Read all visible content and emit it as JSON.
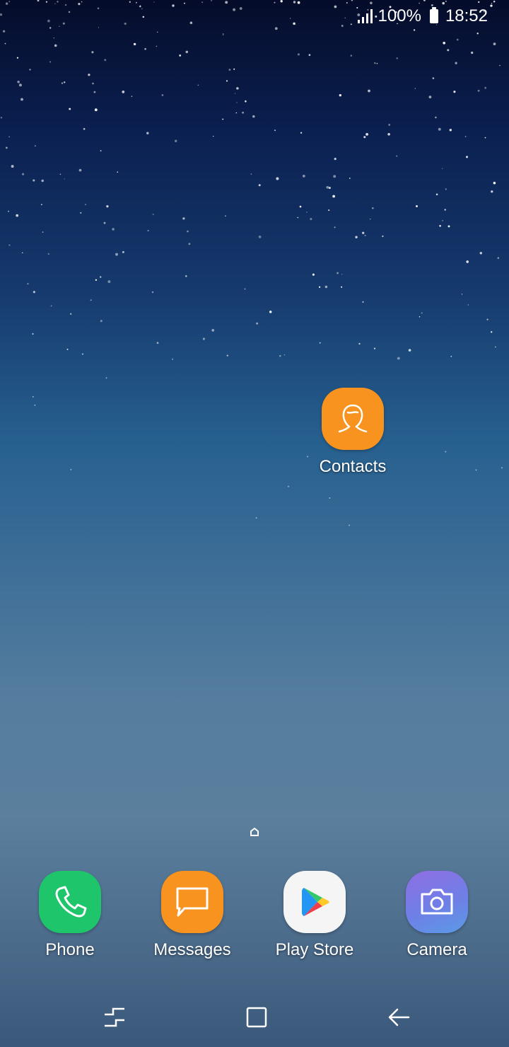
{
  "status_bar": {
    "battery_text": "100%",
    "time": "18:52",
    "icons": [
      "signal-icon",
      "battery-icon"
    ]
  },
  "home_screen": {
    "apps": [
      {
        "label": "Contacts",
        "icon": "contacts-icon",
        "color": "#f7931e"
      }
    ]
  },
  "dock": {
    "apps": [
      {
        "label": "Phone",
        "icon": "phone-icon",
        "color": "#1fc56b"
      },
      {
        "label": "Messages",
        "icon": "messages-icon",
        "color": "#f7931e"
      },
      {
        "label": "Play Store",
        "icon": "play-store-icon",
        "color": "#f5f5f5"
      },
      {
        "label": "Camera",
        "icon": "camera-icon",
        "color": "#6f7fe6"
      }
    ]
  },
  "navigation_bar": {
    "buttons": [
      "recents-icon",
      "home-icon",
      "back-icon"
    ]
  },
  "colors": {
    "wallpaper_top": "#050c2a",
    "wallpaper_bottom": "#3a587a"
  }
}
